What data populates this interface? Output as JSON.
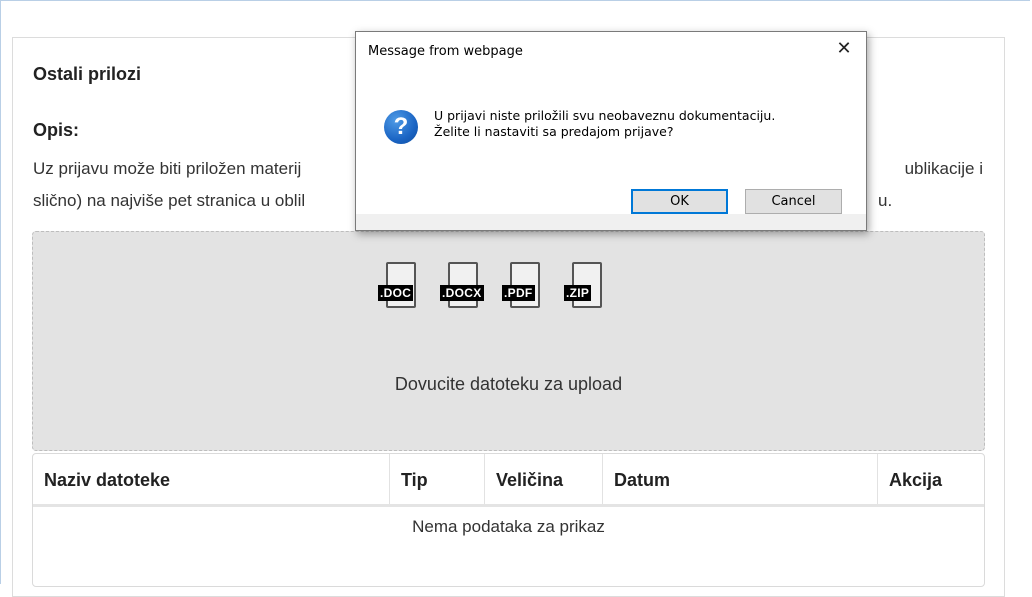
{
  "section": {
    "title": "Ostali prilozi",
    "opis_label": "Opis:",
    "description_lines": [
      "Uz prijavu može biti priložen materij",
      "slično) na najviše pet stranica u oblil"
    ],
    "description_right": [
      "ublikacije i",
      "u."
    ]
  },
  "dropzone": {
    "file_types": [
      ".DOC",
      ".DOCX",
      ".PDF",
      ".ZIP"
    ],
    "text": "Dovucite datoteku za upload"
  },
  "grid": {
    "columns": [
      "Naziv datoteke",
      "Tip",
      "Veličina",
      "Datum",
      "Akcija"
    ],
    "empty_text": "Nema podataka za prikaz"
  },
  "dialog": {
    "title": "Message from webpage",
    "close_glyph": "✕",
    "icon": "question-icon",
    "icon_glyph": "?",
    "message_line1": "U prijavi niste priložili svu neobaveznu dokumentaciju.",
    "message_line2": "Želite li nastaviti sa predajom prijave?",
    "ok_label": "OK",
    "cancel_label": "Cancel"
  },
  "colors": {
    "accent": "#0078d7",
    "dropzone_bg": "#e3e3e3",
    "icon_blue": "#1b65c4"
  }
}
